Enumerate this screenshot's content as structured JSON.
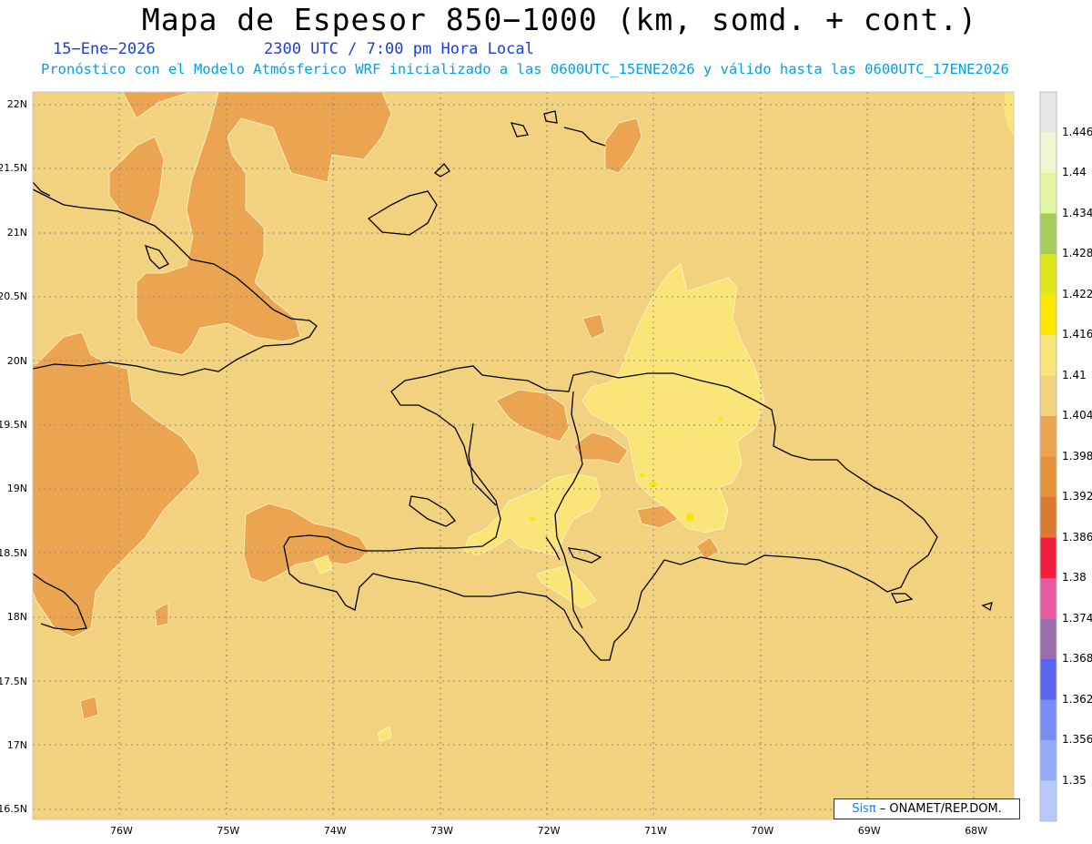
{
  "title": "Mapa de Espesor 850−1000 (km, somd. + cont.)",
  "date": "15−Ene−2026",
  "time": "2300 UTC / 7:00 pm Hora Local",
  "forecast_info": "Pronóstico con el Modelo Atmósferico WRF inicializado a las 0600UTC_15ENE2026 y válido hasta las  0600UTC_17ENE2026",
  "credit": {
    "brand": "Sisπ",
    "text": " – ONAMET/REP.DOM."
  },
  "lat_labels": [
    "22N",
    "21.5N",
    "21N",
    "20.5N",
    "20N",
    "19.5N",
    "19N",
    "18.5N",
    "18N",
    "17.5N",
    "17N",
    "16.5N"
  ],
  "lon_labels": [
    "76W",
    "75W",
    "74W",
    "73W",
    "72W",
    "71W",
    "70W",
    "69W",
    "68W"
  ],
  "colorbar": {
    "labels": [
      "1.446",
      "1.44",
      "1.434",
      "1.428",
      "1.422",
      "1.416",
      "1.41",
      "1.404",
      "1.398",
      "1.392",
      "1.386",
      "1.38",
      "1.374",
      "1.368",
      "1.362",
      "1.356",
      "1.35"
    ],
    "colors": [
      "#e6e6e6",
      "#eef6d2",
      "#e2f5a0",
      "#a5cd5a",
      "#e1e61a",
      "#fae600",
      "#fae678",
      "#f2d17f",
      "#eba550",
      "#e6913c",
      "#dc7a32",
      "#f01e3c",
      "#e65aa0",
      "#9b6eaa",
      "#5a64f0",
      "#788cf5",
      "#96acf8",
      "#b9c8fa"
    ]
  },
  "colors": {
    "field_base": "#f2d17f",
    "field_dark": "#eba550",
    "field_light": "#fae678",
    "field_yellow": "#fae600",
    "coast": "#000000"
  }
}
